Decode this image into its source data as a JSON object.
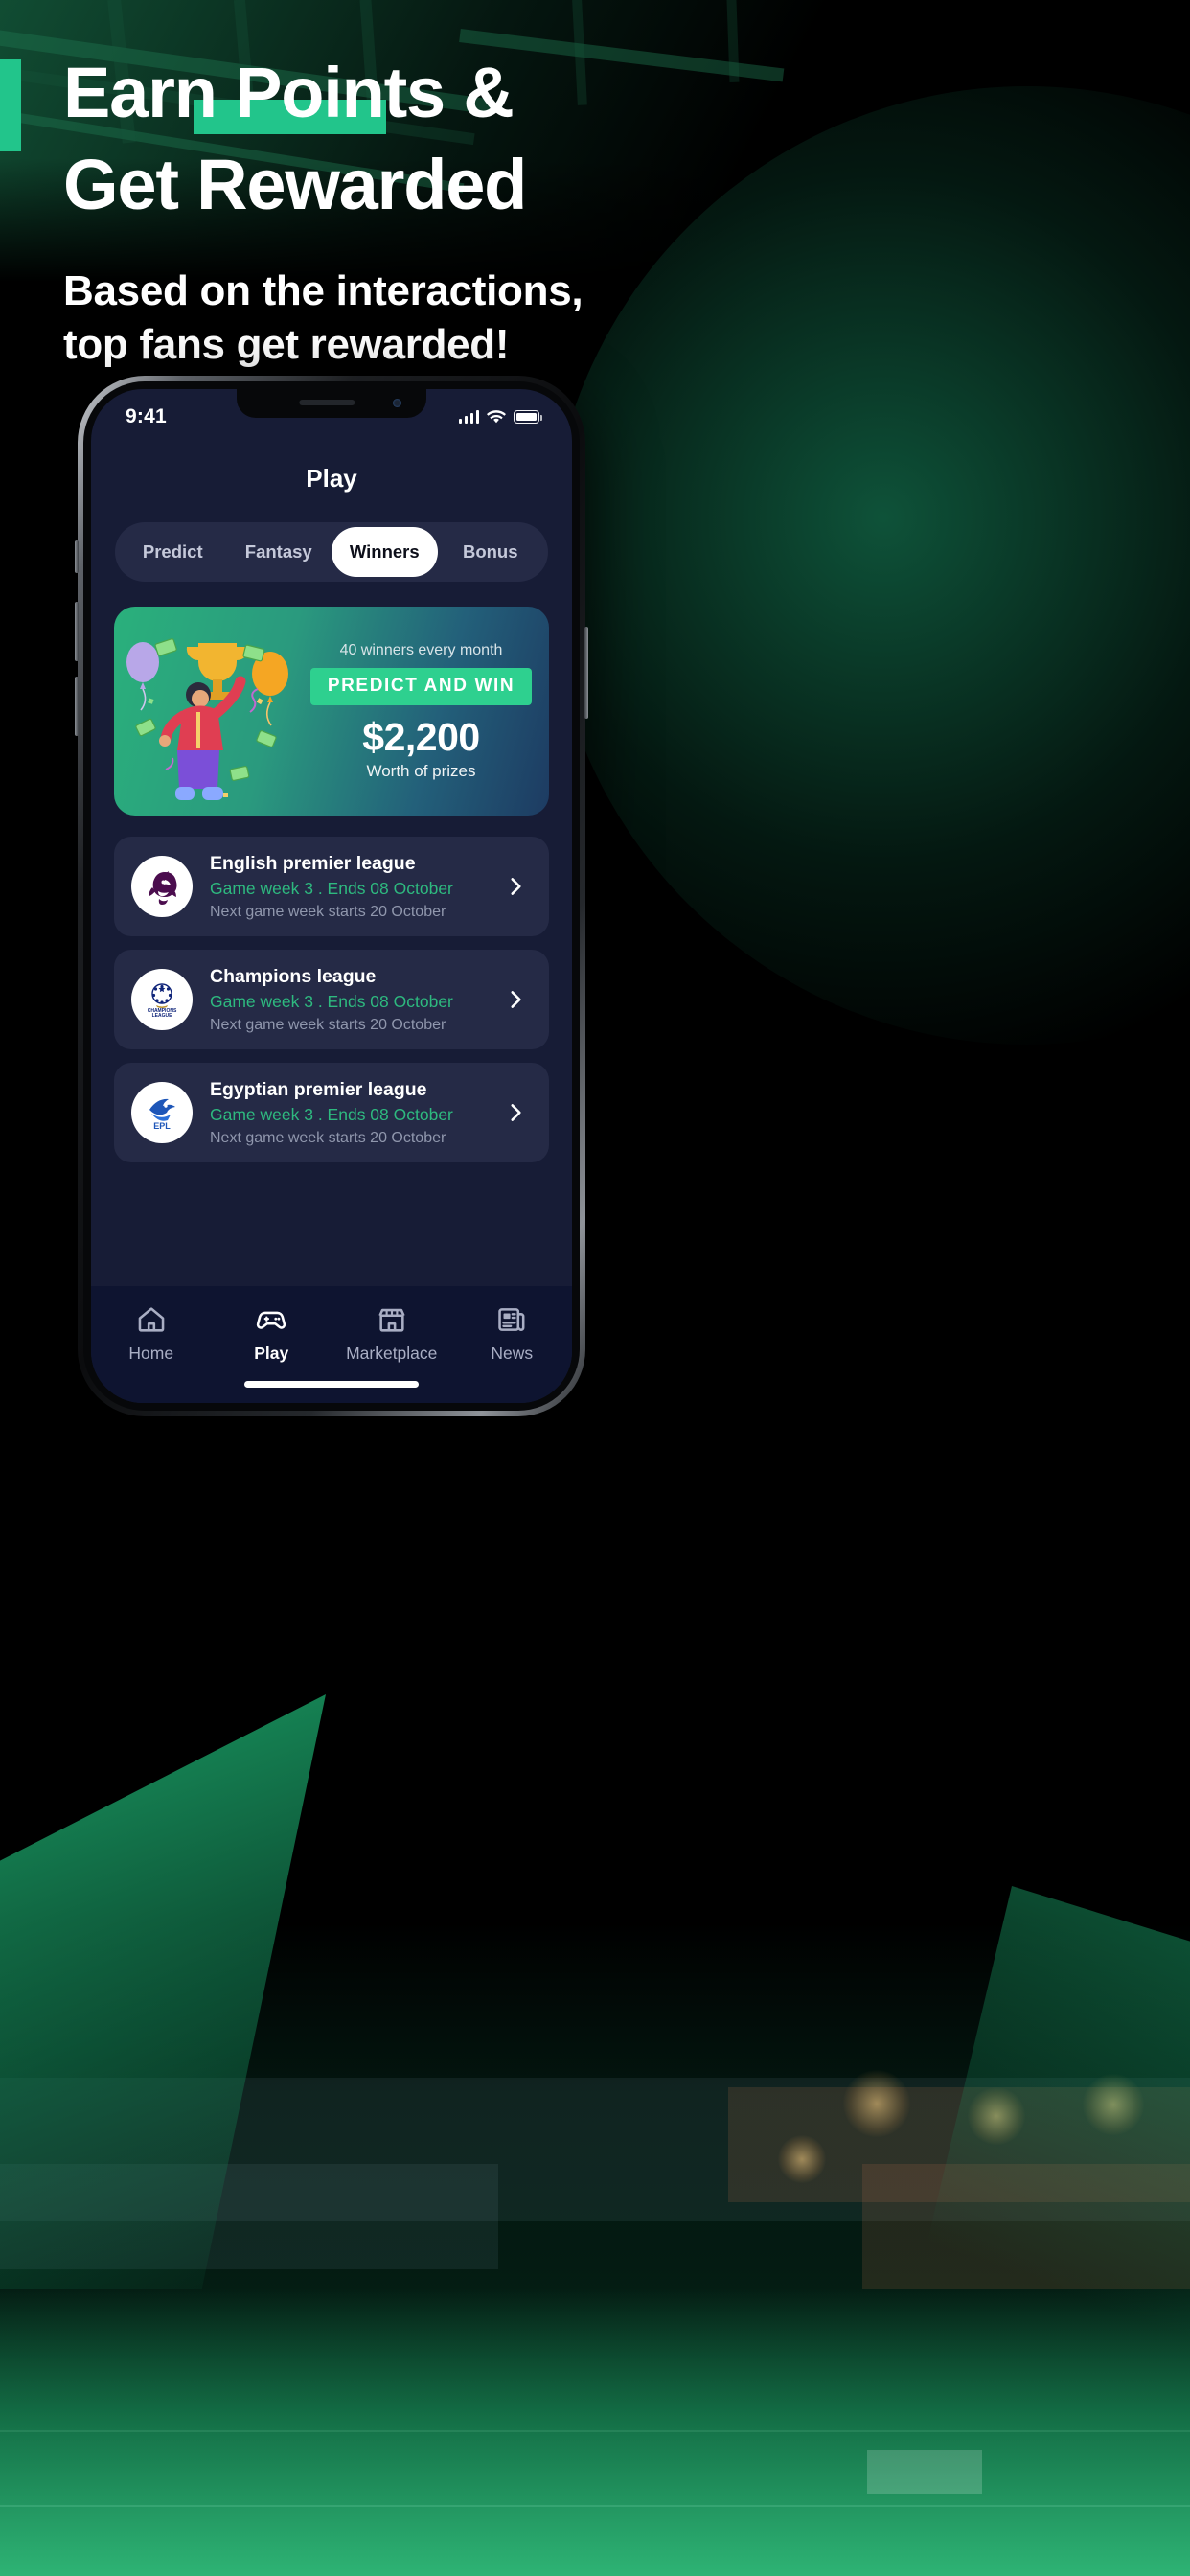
{
  "hero": {
    "headline_line1_pre": "Earn ",
    "headline_line1_mark": "Points &",
    "headline_line2": "Get Rewarded",
    "sub_line1": "Based on the interactions,",
    "sub_line2": "top fans get rewarded!"
  },
  "colors": {
    "accent_green": "#22c58b",
    "badge_green": "#2ed08f",
    "meta_green": "#2eb97f",
    "screen_bg": "#171c36",
    "card_bg": "#252a46",
    "tabbar_bg": "#0e1430"
  },
  "phone": {
    "status": {
      "time": "9:41",
      "signal_icon": "cellular-signal-icon",
      "wifi_icon": "wifi-icon",
      "battery_icon": "battery-full-icon"
    },
    "title": "Play",
    "segments": [
      {
        "label": "Predict",
        "active": false
      },
      {
        "label": "Fantasy",
        "active": false
      },
      {
        "label": "Winners",
        "active": true
      },
      {
        "label": "Bonus",
        "active": false
      }
    ],
    "promo": {
      "subtitle": "40 winners every month",
      "badge": "PREDICT AND WIN",
      "amount": "$2,200",
      "worth": "Worth of prizes"
    },
    "leagues": [
      {
        "name": "English premier league",
        "meta": "Game week 3 . Ends 08 October",
        "next": "Next game week starts 20 October",
        "logo": "premier-league-lion-logo"
      },
      {
        "name": "Champions league",
        "meta": "Game week 3 . Ends 08 October",
        "next": "Next game week starts 20 October",
        "logo": "champions-league-star-ball-logo"
      },
      {
        "name": "Egyptian premier league",
        "meta": "Game week 3 . Ends 08 October",
        "next": "Next game week starts 20 October",
        "logo": "egyptian-premier-league-logo"
      }
    ],
    "tabs": [
      {
        "label": "Home",
        "icon": "home-icon",
        "active": false
      },
      {
        "label": "Play",
        "icon": "gamepad-icon",
        "active": true
      },
      {
        "label": "Marketplace",
        "icon": "storefront-icon",
        "active": false
      },
      {
        "label": "News",
        "icon": "newspaper-icon",
        "active": false
      }
    ]
  }
}
